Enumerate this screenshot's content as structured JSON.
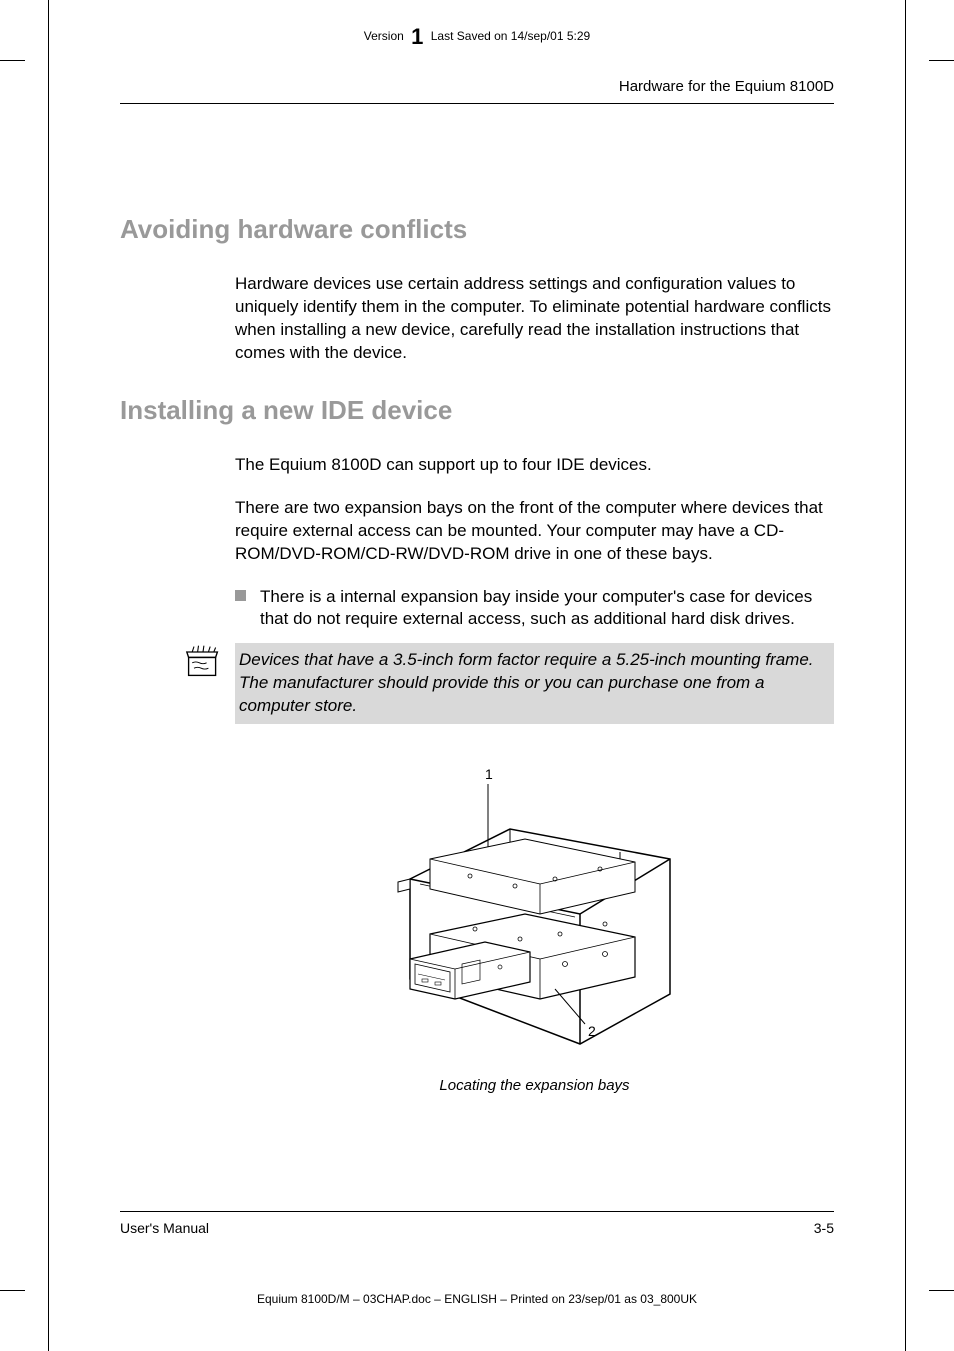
{
  "topHeader": {
    "versionLabel": "Version",
    "versionNumber": "1",
    "savedText": "Last Saved on 14/sep/01 5:29"
  },
  "runningHeader": "Hardware for the Equium 8100D",
  "section1": {
    "title": "Avoiding hardware conflicts",
    "para1": "Hardware devices use certain address settings and configuration values to uniquely identify them in the computer. To eliminate potential hardware conflicts when installing a new device, carefully read the installation instructions that comes with the device."
  },
  "section2": {
    "title": "Installing a new IDE device",
    "para1": "The Equium 8100D can support up to four IDE devices.",
    "para2": "There are two expansion bays on the front of the computer where devices that require external access can be mounted. Your computer may have a CD-ROM/DVD-ROM/CD-RW/DVD-ROM drive in one of these bays.",
    "bullet1": "There is a internal expansion bay inside your computer's case for devices that do not require external access, such as additional hard disk drives.",
    "note": "Devices that have a 3.5-inch form factor require a 5.25-inch mounting frame. The manufacturer should provide this or you can purchase one from a computer store.",
    "figureLabel1": "1",
    "figureLabel2": "2",
    "figureCaption": "Locating the expansion bays"
  },
  "footer": {
    "left": "User's Manual",
    "right": "3-5"
  },
  "printFooter": "Equium 8100D/M  – 03CHAP.doc – ENGLISH – Printed on 23/sep/01 as 03_800UK"
}
